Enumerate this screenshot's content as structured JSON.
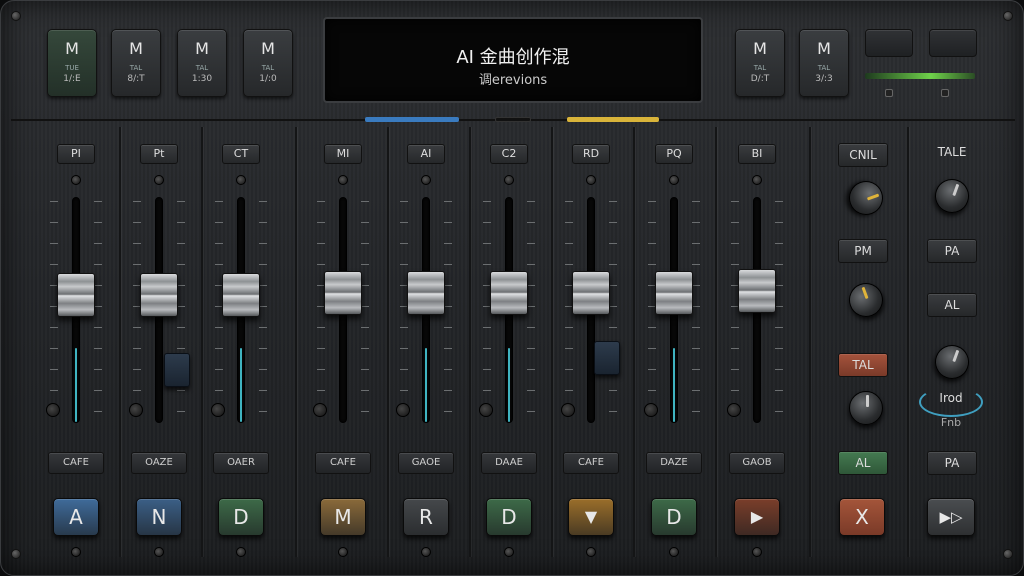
{
  "top_buttons": [
    {
      "big": "M",
      "sm1": "TUE",
      "sm2": "1/:E"
    },
    {
      "big": "M",
      "sm1": "TAL",
      "sm2": "8/:T"
    },
    {
      "big": "M",
      "sm1": "TAL",
      "sm2": "1:30"
    },
    {
      "big": "M",
      "sm1": "TAL",
      "sm2": "1/:0"
    },
    {
      "big": "M",
      "sm1": "TAL",
      "sm2": "D/:T"
    },
    {
      "big": "M",
      "sm1": "TAL",
      "sm2": "3/:3"
    }
  ],
  "display": {
    "title": "AI 金曲创作混",
    "subtitle": "调erevions"
  },
  "channels": [
    {
      "label": "PI",
      "gain": "CAFE",
      "btn": "A",
      "btn_color": "#3f6b9a",
      "level": 0.33
    },
    {
      "label": "Pt",
      "gain": "OAZE",
      "btn": "N",
      "btn_color": "#3b5f86",
      "level": 0.0
    },
    {
      "label": "CT",
      "gain": "OAER",
      "btn": "D",
      "btn_color": "#3d6a48",
      "level": 0.33
    },
    {
      "label": "MI",
      "gain": "CAFE",
      "btn": "M",
      "btn_color": "#8a6a3a",
      "level": 0.0
    },
    {
      "label": "AI",
      "gain": "GAOE",
      "btn": "R",
      "btn_color": "#45484b",
      "level": 0.33
    },
    {
      "label": "C2",
      "gain": "DAAE",
      "btn": "D",
      "btn_color": "#3d6a48",
      "level": 0.33
    },
    {
      "label": "RD",
      "gain": "CAFE",
      "btn": "▼",
      "btn_color": "#9a6e2a",
      "level": 0.0
    },
    {
      "label": "PQ",
      "gain": "DAZE",
      "btn": "D",
      "btn_color": "#3d6a48",
      "level": 0.33
    },
    {
      "label": "BI",
      "gain": "GAOB",
      "btn": "▶",
      "btn_color": "#7a3e2a",
      "level": 0.0
    }
  ],
  "right_panel": {
    "col1": {
      "header": "CNIL",
      "btn1": "PM",
      "btn2": "TAL",
      "btn3": "AL",
      "big_btn": "X"
    },
    "col2": {
      "header": "TALE",
      "btn1": "PA",
      "btn2": "AL",
      "ring_label": "Irod",
      "ring_sub": "Fnb",
      "btn3": "PA",
      "big_btn": "▶▷"
    }
  },
  "colors": {
    "led_blue": "#3a7bbf",
    "led_yellow": "#d9b43a",
    "meter_green": "#6fd24a",
    "fader_fill": "#3fb3c0",
    "tal_red": "#9a4a35",
    "al_green": "#3f6f49"
  }
}
